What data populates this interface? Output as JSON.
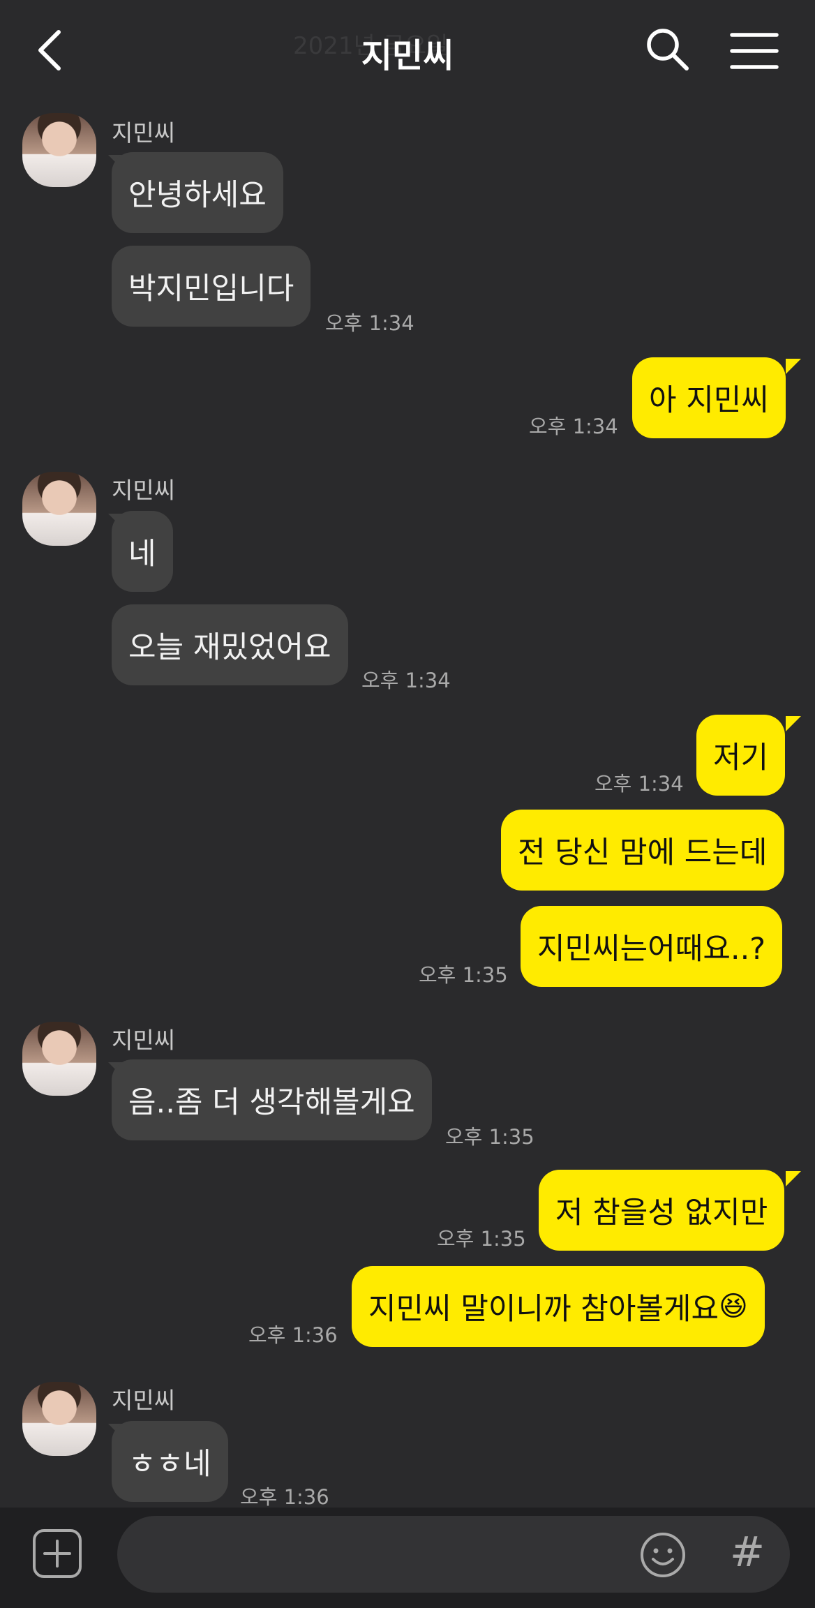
{
  "header": {
    "date": "2021년 금요일",
    "title": "지민씨"
  },
  "messages": [
    {
      "sender": "지민씨",
      "text": "안녕하세요"
    },
    {
      "text": "박지민입니다",
      "time": "오후 1:34"
    },
    {
      "text": "아 지민씨",
      "time": "오후 1:34"
    },
    {
      "sender": "지민씨",
      "text": "네"
    },
    {
      "text": "오늘 재밌었어요",
      "time": "오후 1:34"
    },
    {
      "text": "저기",
      "time": "오후 1:34"
    },
    {
      "text": "전 당신 맘에 드는데"
    },
    {
      "text": "지민씨는어때요..?",
      "time": "오후 1:35"
    },
    {
      "sender": "지민씨",
      "text": "음..좀 더 생각해볼게요",
      "time": "오후 1:35"
    },
    {
      "text": "저 참을성 없지만",
      "time": "오후 1:35"
    },
    {
      "text": "지민씨 말이니까 참아볼게요",
      "emoji": "😆",
      "time": "오후 1:36"
    },
    {
      "sender": "지민씨",
      "text": "ㅎㅎ네",
      "time": "오후 1:36"
    }
  ],
  "input": {
    "placeholder": "",
    "hash_label": "#"
  },
  "colors": {
    "background": "#2a2a2c",
    "incoming_bubble": "#414141",
    "outgoing_bubble": "#ffeb00"
  },
  "icons": [
    "back-arrow-icon",
    "search-icon",
    "menu-icon",
    "plus-icon",
    "emoji-icon",
    "hash-icon"
  ]
}
